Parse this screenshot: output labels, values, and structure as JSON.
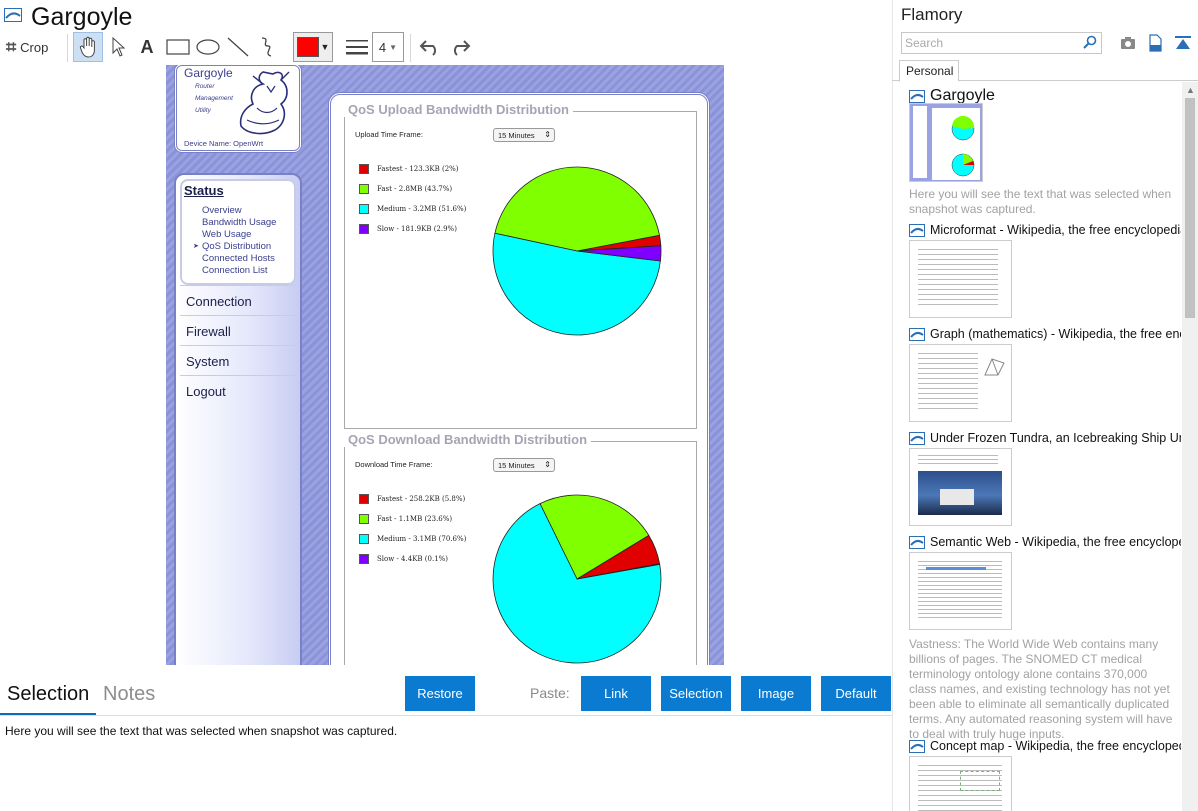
{
  "window": {
    "title": "Gargoyle",
    "icon": "snapshot-icon"
  },
  "toolbar": {
    "crop_label": "Crop",
    "tools": [
      "crop-icon",
      "hand-icon",
      "pointer-icon",
      "text-icon",
      "rectangle-icon",
      "ellipse-icon",
      "line-icon",
      "freehand-icon"
    ],
    "color": "#ff0000",
    "line_width": "4",
    "undo_icon": "undo-icon",
    "redo_icon": "redo-icon"
  },
  "capture": {
    "brand": "Gargoyle",
    "subtitle": [
      "Router",
      "Management",
      "Utility"
    ],
    "device_name": "Device Name: OpenWrt",
    "nav": {
      "status": "Status",
      "sub_items": [
        "Overview",
        "Bandwidth Usage",
        "Web Usage",
        "QoS Distribution",
        "Connected Hosts",
        "Connection List"
      ],
      "current": "QoS Distribution",
      "main_items": [
        "Connection",
        "Firewall",
        "System",
        "Logout"
      ]
    },
    "upload": {
      "title": "QoS Upload Bandwidth Distribution",
      "time_label": "Upload Time Frame:",
      "time_value": "15 Minutes",
      "legend": [
        "Fastest - 123.3KB (2%)",
        "Fast - 2.8MB (43.7%)",
        "Medium - 3.2MB (51.6%)",
        "Slow - 181.9KB (2.9%)"
      ],
      "values": [
        2,
        43.7,
        51.6,
        2.9
      ]
    },
    "download": {
      "title": "QoS Download Bandwidth Distribution",
      "time_label": "Download Time Frame:",
      "time_value": "15 Minutes",
      "legend": [
        "Fastest - 258.2KB (5.8%)",
        "Fast - 1.1MB (23.6%)",
        "Medium - 3.1MB (70.6%)",
        "Slow - 4.4KB (0.1%)"
      ],
      "values": [
        5.8,
        23.6,
        70.6,
        0.1
      ]
    },
    "slice_colors": [
      "#e00000",
      "#80ff00",
      "#00ffff",
      "#8000ff"
    ]
  },
  "bottom": {
    "tabs": [
      "Selection",
      "Notes"
    ],
    "active_tab": "Selection",
    "restore": "Restore",
    "paste_label": "Paste:",
    "paste_buttons": [
      "Link",
      "Selection",
      "Image",
      "Default"
    ],
    "selection_text": "Here you will see the text that was selected when snapshot was captured."
  },
  "sidebar": {
    "title": "Flamory",
    "search_placeholder": "Search",
    "icons": [
      "search-icon",
      "camera-icon",
      "document-icon",
      "collapse-icon"
    ],
    "tab": "Personal",
    "snapshots": [
      {
        "title": "Gargoyle",
        "desc": "Here you will see the text that was selected when snapshot was captured."
      },
      {
        "title": "Microformat - Wikipedia, the free encyclopedia",
        "desc": ""
      },
      {
        "title": "Graph (mathematics) - Wikipedia, the free encyclopedia",
        "desc": ""
      },
      {
        "title": "Under Frozen Tundra, an Icebreaking Ship Uncovers a Lost World",
        "desc": ""
      },
      {
        "title": "Semantic Web - Wikipedia, the free encyclopedia",
        "desc": "Vastness: The World Wide Web contains many billions of pages. The SNOMED CT medical terminology ontology alone contains 370,000 class names, and existing technology has not yet been able to eliminate all semantically duplicated terms. Any automated reasoning system will have to deal with truly huge inputs."
      },
      {
        "title": "Concept map - Wikipedia, the free encyclopedia",
        "desc": ""
      }
    ]
  }
}
